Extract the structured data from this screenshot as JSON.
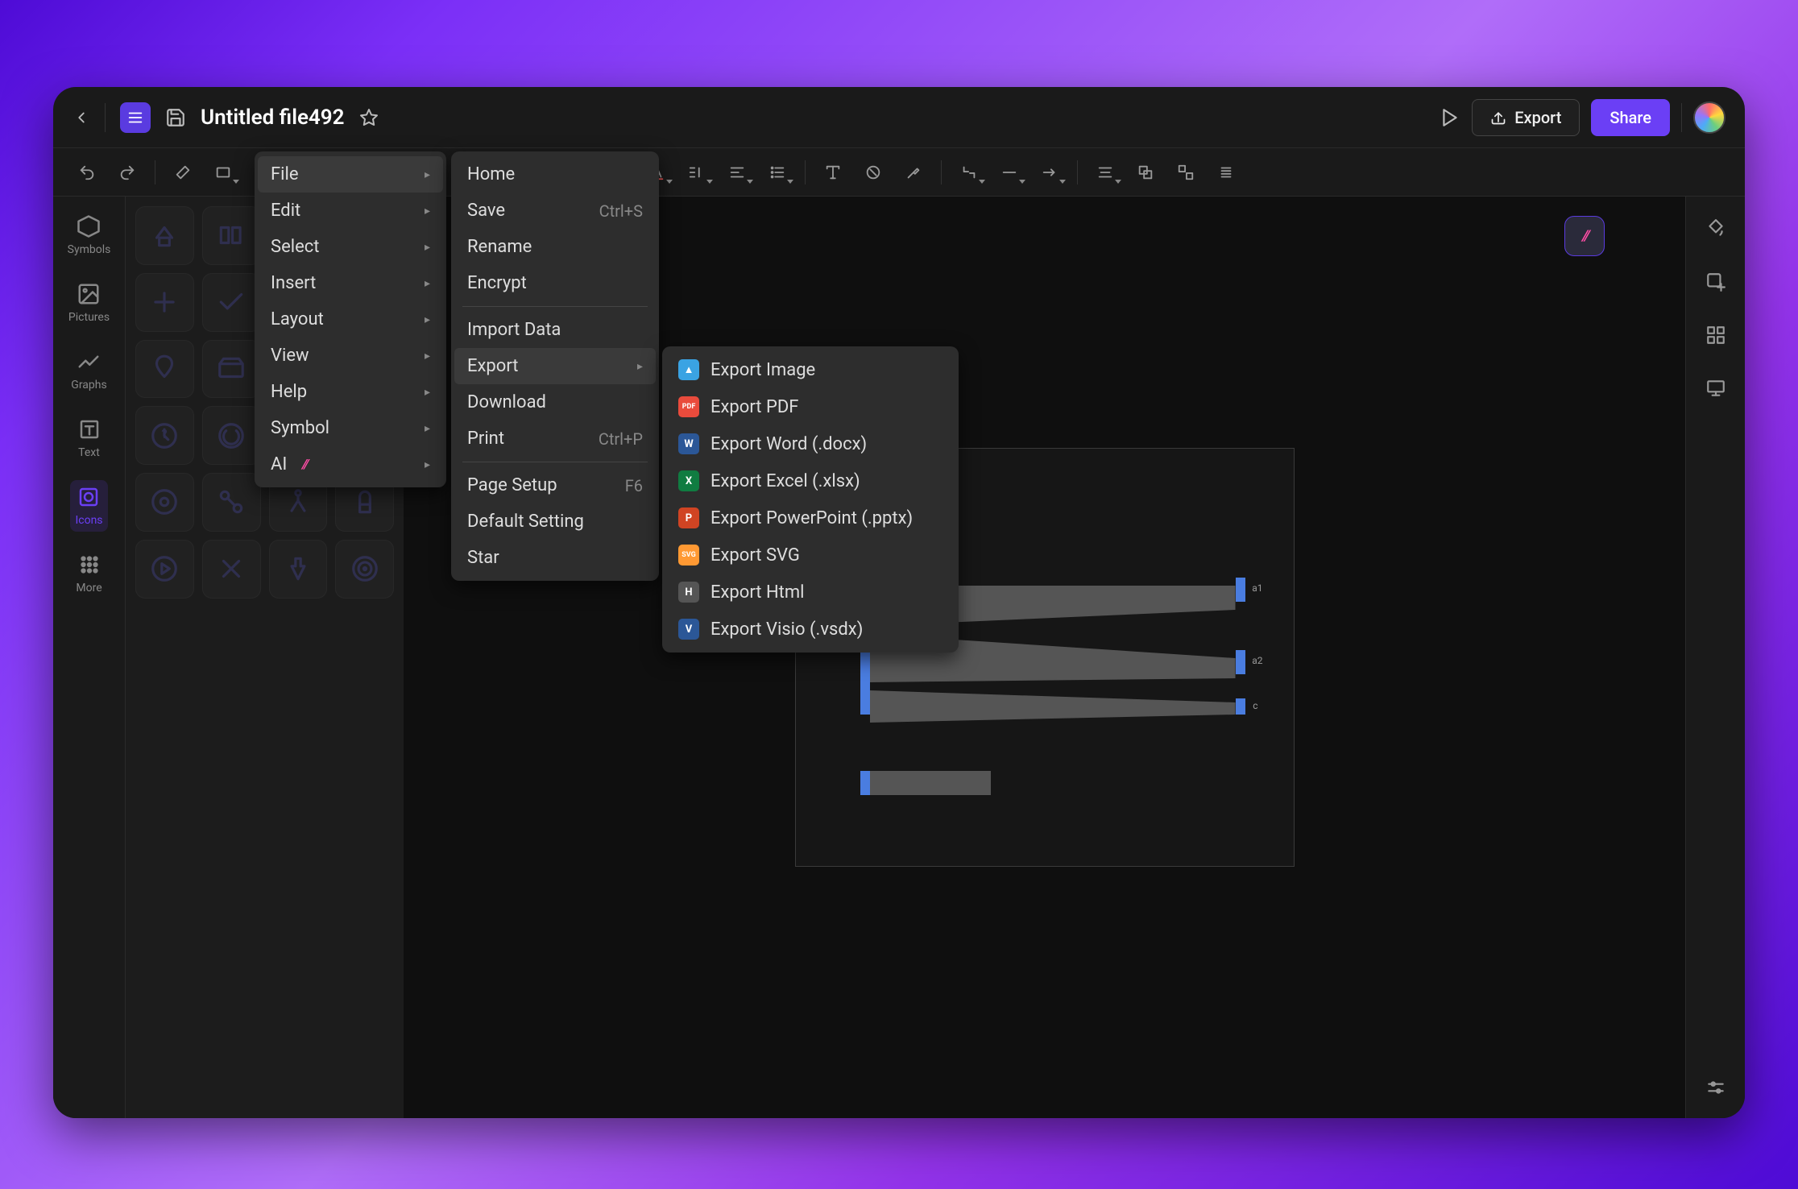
{
  "header": {
    "title": "Untitled file492",
    "export_btn": "Export",
    "share_btn": "Share"
  },
  "left_rail": [
    {
      "label": "Symbols"
    },
    {
      "label": "Pictures"
    },
    {
      "label": "Graphs"
    },
    {
      "label": "Text"
    },
    {
      "label": "Icons"
    },
    {
      "label": "More"
    }
  ],
  "main_menu": [
    {
      "label": "File",
      "submenu": true,
      "hover": true
    },
    {
      "label": "Edit",
      "submenu": true
    },
    {
      "label": "Select",
      "submenu": true
    },
    {
      "label": "Insert",
      "submenu": true
    },
    {
      "label": "Layout",
      "submenu": true
    },
    {
      "label": "View",
      "submenu": true
    },
    {
      "label": "Help",
      "submenu": true
    },
    {
      "label": "Symbol",
      "submenu": true
    },
    {
      "label": "AI",
      "submenu": true,
      "ai": true
    }
  ],
  "file_menu": [
    {
      "label": "Home"
    },
    {
      "label": "Save",
      "shortcut": "Ctrl+S"
    },
    {
      "label": "Rename"
    },
    {
      "label": "Encrypt"
    },
    {
      "sep": true
    },
    {
      "label": "Import Data"
    },
    {
      "label": "Export",
      "submenu": true,
      "hover": true
    },
    {
      "label": "Download"
    },
    {
      "label": "Print",
      "shortcut": "Ctrl+P"
    },
    {
      "sep": true
    },
    {
      "label": "Page Setup",
      "shortcut": "F6"
    },
    {
      "label": "Default Setting"
    },
    {
      "label": "Star"
    }
  ],
  "export_menu": [
    {
      "label": "Export Image",
      "icon_bg": "#3aa3e3",
      "icon_text": "▲"
    },
    {
      "label": "Export PDF",
      "icon_bg": "#e94b3c",
      "icon_text": "PDF"
    },
    {
      "label": "Export Word (.docx)",
      "icon_bg": "#2b5797",
      "icon_text": "W"
    },
    {
      "label": "Export Excel (.xlsx)",
      "icon_bg": "#107c41",
      "icon_text": "X"
    },
    {
      "label": "Export PowerPoint (.pptx)",
      "icon_bg": "#d04423",
      "icon_text": "P"
    },
    {
      "label": "Export SVG",
      "icon_bg": "#ff9933",
      "icon_text": "SVG"
    },
    {
      "label": "Export Html",
      "icon_bg": "#555",
      "icon_text": "H"
    },
    {
      "label": "Export Visio (.vsdx)",
      "icon_bg": "#2b5797",
      "icon_text": "V"
    }
  ],
  "canvas": {
    "labels": [
      "a1",
      "a2",
      "c"
    ]
  }
}
